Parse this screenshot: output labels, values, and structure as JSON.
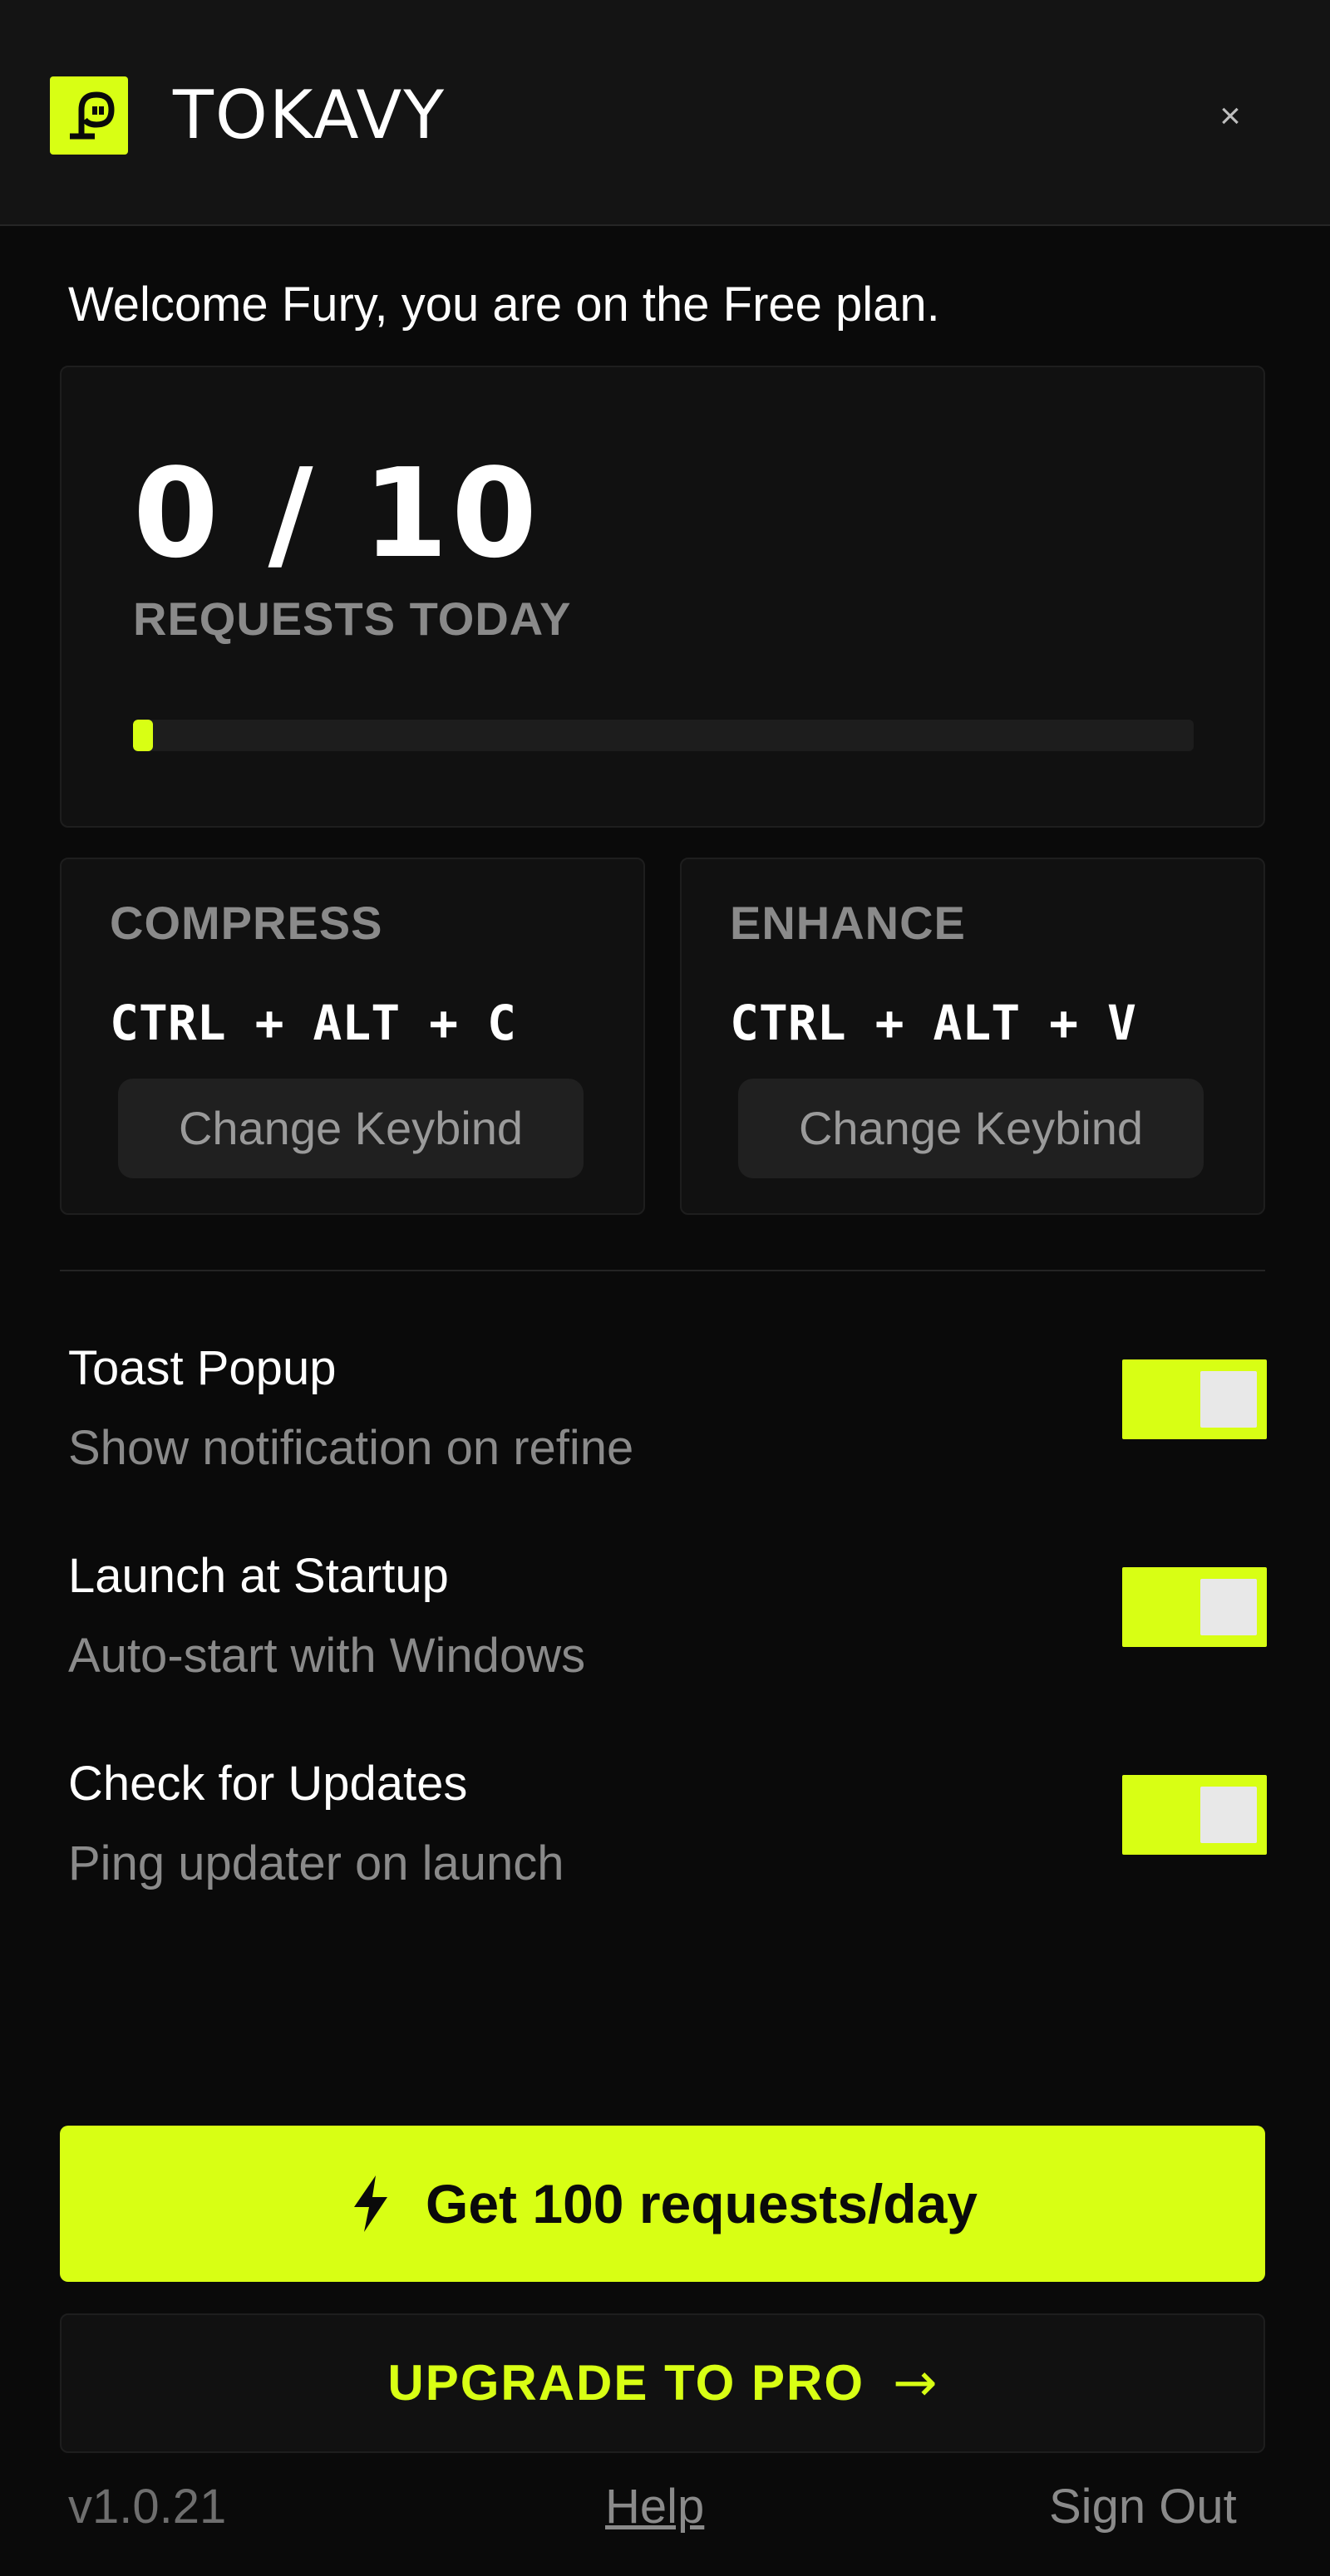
{
  "app": {
    "title": "TOKAVY",
    "logo_icon": "tokavy-logo-icon",
    "close_label": "×"
  },
  "welcome": "Welcome Fury, you are on the Free plan.",
  "usage": {
    "count_text": "0 / 10",
    "used": 0,
    "limit": 10,
    "label": "REQUESTS TODAY",
    "progress_fraction": 0.0
  },
  "keybinds": {
    "compress": {
      "title": "COMPRESS",
      "combo": "CTRL + ALT + C",
      "button_label": "Change Keybind"
    },
    "enhance": {
      "title": "ENHANCE",
      "combo": "CTRL + ALT + V",
      "button_label": "Change Keybind"
    }
  },
  "settings": [
    {
      "title": "Toast Popup",
      "description": "Show notification on refine",
      "enabled": true
    },
    {
      "title": "Launch at Startup",
      "description": "Auto-start with Windows",
      "enabled": true
    },
    {
      "title": "Check for Updates",
      "description": "Ping updater on launch",
      "enabled": true
    }
  ],
  "cta": {
    "primary_label": "Get 100 requests/day",
    "primary_icon": "lightning-bolt-icon",
    "secondary_label": "UPGRADE TO PRO",
    "secondary_arrow": "→"
  },
  "footer": {
    "version": "v1.0.21",
    "help": "Help",
    "sign_out": "Sign Out"
  },
  "colors": {
    "accent": "#d8ff14",
    "background": "#0a0a0a",
    "card": "#111111",
    "muted_text": "#8a8a8a"
  }
}
